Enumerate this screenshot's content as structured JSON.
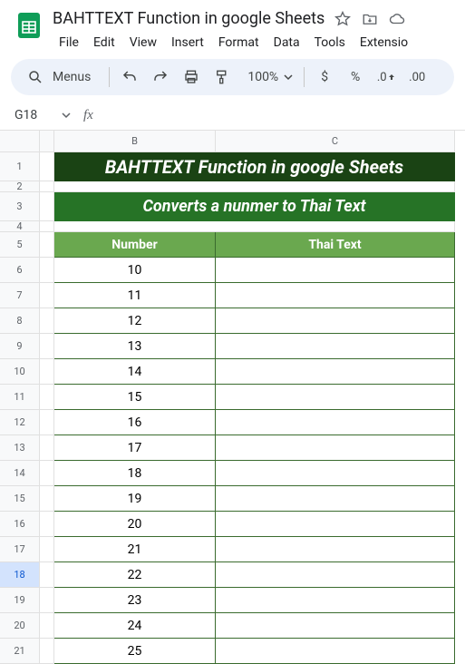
{
  "doc": {
    "title": "BAHTTEXT Function in google Sheets"
  },
  "menus": [
    "File",
    "Edit",
    "View",
    "Insert",
    "Format",
    "Data",
    "Tools",
    "Extensio"
  ],
  "toolbar": {
    "search_label": "Menus",
    "zoom": "100%",
    "currency": "$",
    "percent": "%",
    "dec_dec": ".0",
    "dec_inc": ".00"
  },
  "namebox": "G18",
  "formula": "",
  "col_headers": {
    "b": "B",
    "c": "C"
  },
  "row_nums": [
    "1",
    "2",
    "3",
    "4",
    "5",
    "6",
    "7",
    "8",
    "9",
    "10",
    "11",
    "12",
    "13",
    "14",
    "15",
    "16",
    "17",
    "18",
    "19",
    "20",
    "21"
  ],
  "sheet": {
    "title": "BAHTTEXT Function in google Sheets",
    "subtitle": "Converts a nunmer to Thai Text",
    "hdr_b": "Number",
    "hdr_c": "Thai Text",
    "rows": [
      {
        "n": "10",
        "t": ""
      },
      {
        "n": "11",
        "t": ""
      },
      {
        "n": "12",
        "t": ""
      },
      {
        "n": "13",
        "t": ""
      },
      {
        "n": "14",
        "t": ""
      },
      {
        "n": "15",
        "t": ""
      },
      {
        "n": "16",
        "t": ""
      },
      {
        "n": "17",
        "t": ""
      },
      {
        "n": "18",
        "t": ""
      },
      {
        "n": "19",
        "t": ""
      },
      {
        "n": "20",
        "t": ""
      },
      {
        "n": "21",
        "t": ""
      },
      {
        "n": "22",
        "t": ""
      },
      {
        "n": "23",
        "t": ""
      },
      {
        "n": "24",
        "t": ""
      },
      {
        "n": "25",
        "t": ""
      }
    ]
  }
}
